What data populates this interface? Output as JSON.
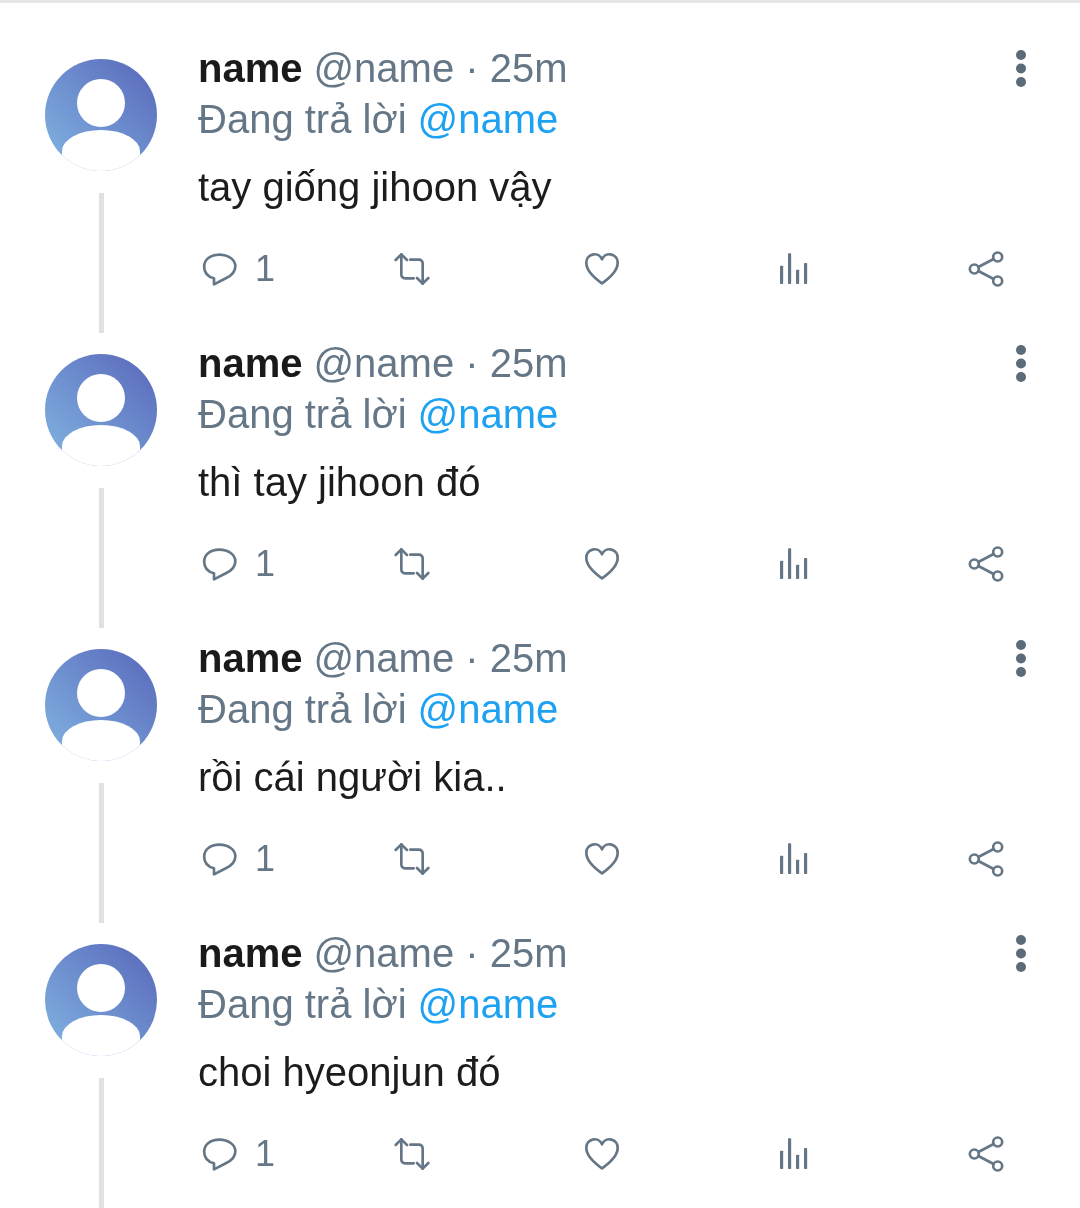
{
  "tweets": [
    {
      "name": "name",
      "meta": "@name · 25m",
      "reply_label": "Đang trả lời",
      "reply_to": "@name",
      "text": "tay giống jihoon vậy",
      "reply_count": "1",
      "thread_continues": true
    },
    {
      "name": "name",
      "meta": "@name · 25m",
      "reply_label": "Đang trả lời",
      "reply_to": "@name",
      "text": "thì tay jihoon đó",
      "reply_count": "1",
      "thread_continues": true
    },
    {
      "name": "name",
      "meta": "@name · 25m",
      "reply_label": "Đang trả lời",
      "reply_to": "@name",
      "text": "rồi cái người kia..",
      "reply_count": "1",
      "thread_continues": true
    },
    {
      "name": "name",
      "meta": "@name · 25m",
      "reply_label": "Đang trả lời",
      "reply_to": "@name",
      "text": "choi hyeonjun đó",
      "reply_count": "1",
      "thread_continues": true
    }
  ]
}
